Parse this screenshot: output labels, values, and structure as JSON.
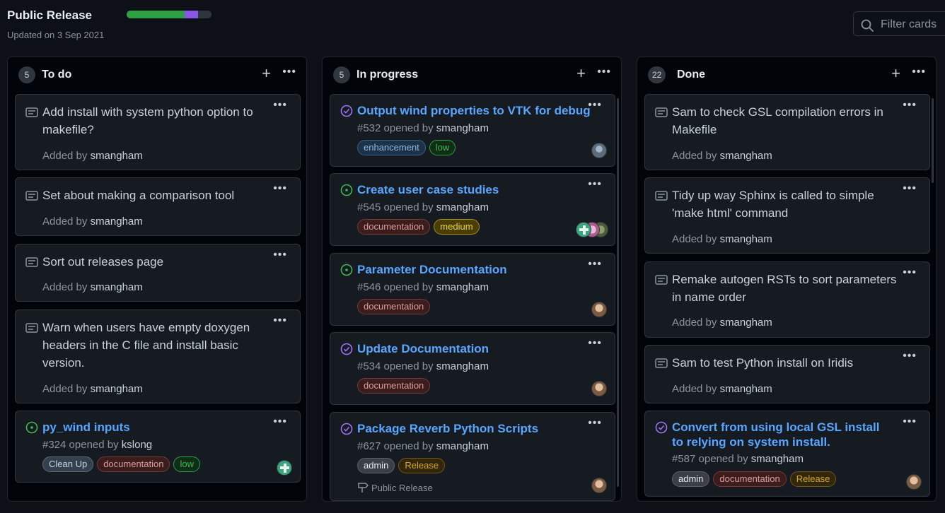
{
  "project": {
    "title": "Public Release",
    "updated": "Updated on 3 Sep 2021",
    "progress": {
      "done_fraction": 0.68,
      "in_progress_fraction": 0.16,
      "done_color": "#2ea043",
      "in_progress_color": "#8957e5"
    }
  },
  "filter": {
    "placeholder": "Filter cards"
  },
  "columns": [
    {
      "title": "To do",
      "count": "5",
      "cards": [
        {
          "type": "note",
          "text": "Add install with system python option to makefile?",
          "added_prefix": "Added by",
          "user": "smangham"
        },
        {
          "type": "note",
          "text": "Set about making a comparison tool",
          "added_prefix": "Added by",
          "user": "smangham"
        },
        {
          "type": "note",
          "text": "Sort out releases page",
          "added_prefix": "Added by",
          "user": "smangham"
        },
        {
          "type": "note",
          "text": "Warn when users have empty doxygen headers in the C file and install basic version.",
          "added_prefix": "Added by",
          "user": "smangham"
        },
        {
          "type": "issue",
          "state": "open",
          "title": "py_wind inputs",
          "meta": "#324 opened by",
          "user": "kslong",
          "labels": [
            "Clean Up",
            "documentation",
            "low"
          ]
        }
      ]
    },
    {
      "title": "In progress",
      "count": "5",
      "cards": [
        {
          "type": "issue",
          "state": "closed",
          "title": "Output wind properties to VTK for debug",
          "meta": "#532 opened by",
          "user": "smangham",
          "labels": [
            "enhancement",
            "low"
          ]
        },
        {
          "type": "issue",
          "state": "open",
          "title": "Create user case studies",
          "meta": "#545 opened by",
          "user": "smangham",
          "labels": [
            "documentation",
            "medium"
          ]
        },
        {
          "type": "issue",
          "state": "open",
          "title": "Parameter Documentation",
          "meta": "#546 opened by",
          "user": "smangham",
          "labels": [
            "documentation"
          ]
        },
        {
          "type": "issue",
          "state": "closed",
          "title": "Update Documentation",
          "meta": "#534 opened by",
          "user": "smangham",
          "labels": [
            "documentation"
          ]
        },
        {
          "type": "issue",
          "state": "closed",
          "title": "Package Reverb Python Scripts",
          "meta": "#627 opened by",
          "user": "smangham",
          "labels": [
            "admin",
            "Release"
          ],
          "milestone": "Public Release"
        }
      ]
    },
    {
      "title": "Done",
      "count": "22",
      "cards": [
        {
          "type": "note",
          "text": "Sam to check GSL compilation errors in Makefile",
          "added_prefix": "Added by",
          "user": "smangham"
        },
        {
          "type": "note",
          "text": "Tidy up way Sphinx is called to simple 'make html' command",
          "added_prefix": "Added by",
          "user": "smangham"
        },
        {
          "type": "note",
          "text": "Remake autogen RSTs to sort parameters in name order",
          "added_prefix": "Added by",
          "user": "smangham"
        },
        {
          "type": "note",
          "text": "Sam to test Python install on Iridis",
          "added_prefix": "Added by",
          "user": "smangham"
        },
        {
          "type": "issue",
          "state": "closed",
          "title": "Convert from using local GSL install to relying on system install.",
          "meta": "#587 opened by",
          "user": "smangham",
          "labels": [
            "admin",
            "documentation",
            "Release"
          ]
        }
      ]
    }
  ],
  "icons": {
    "note": "note-icon",
    "issue_open": "issue-open-icon",
    "issue_closed": "issue-closed-icon",
    "milestone": "milestone-icon",
    "search": "search-icon",
    "add": "plus-icon",
    "more": "kebab-icon"
  }
}
